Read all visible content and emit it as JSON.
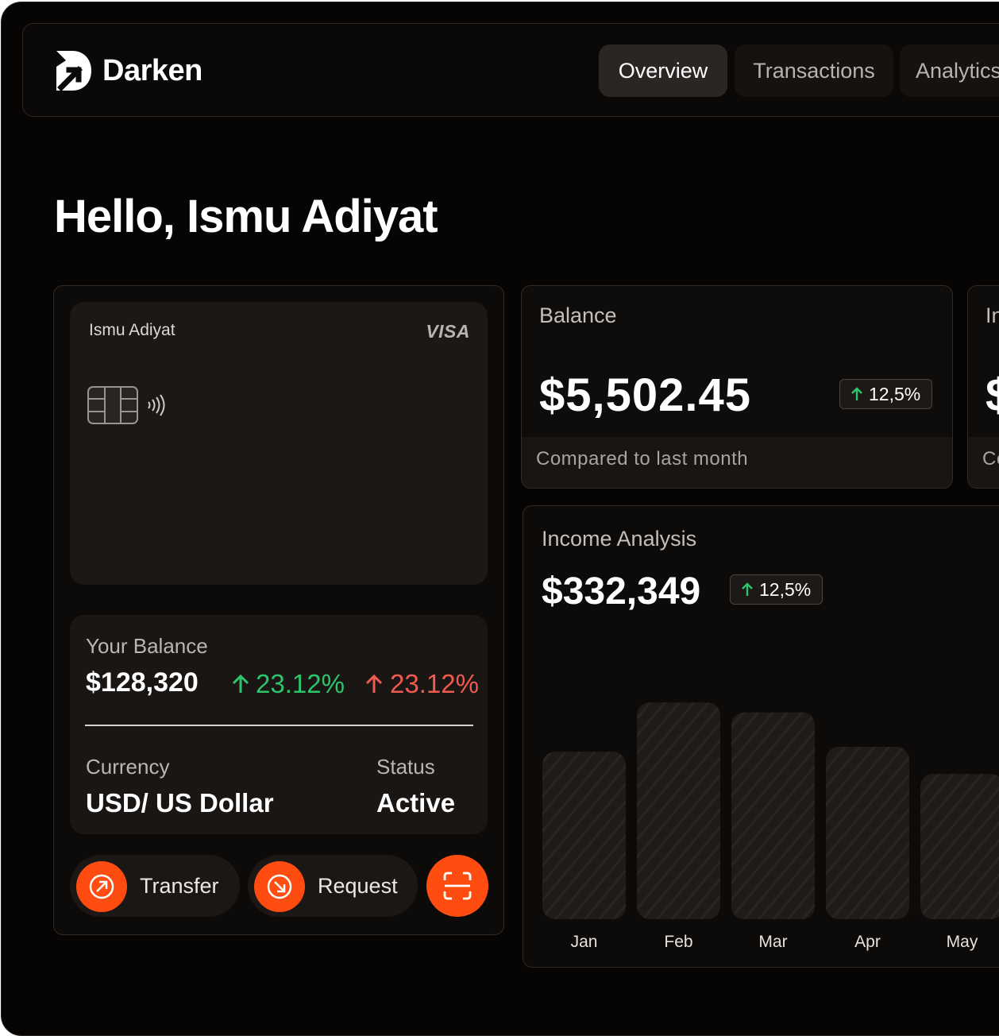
{
  "app": {
    "name": "Darken"
  },
  "nav": {
    "tabs": [
      {
        "label": "Overview",
        "active": true
      },
      {
        "label": "Transactions",
        "active": false
      },
      {
        "label": "Analytics",
        "active": false
      }
    ]
  },
  "greeting": "Hello, Ismu Adiyat",
  "card": {
    "holder": "Ismu Adiyat",
    "brand": "VISA"
  },
  "wallet": {
    "balance_label": "Your Balance",
    "balance_value": "$128,320",
    "change_up": "23.12%",
    "change_down": "23.12%",
    "currency_label": "Currency",
    "currency_value": "USD/ US Dollar",
    "status_label": "Status",
    "status_value": "Active",
    "actions": {
      "transfer": "Transfer",
      "request": "Request"
    }
  },
  "balance_card": {
    "title": "Balance",
    "value": "$5,502.45",
    "change": "12,5%",
    "footer": "Compared to last month"
  },
  "second_card": {
    "title": "In",
    "value": "$",
    "footer": "Co"
  },
  "income": {
    "title": "Income Analysis",
    "value": "$332,349",
    "change": "12,5%"
  },
  "chart_data": {
    "type": "bar",
    "categories": [
      "Jan",
      "Feb",
      "Mar",
      "Apr",
      "May"
    ],
    "values": [
      0.68,
      0.88,
      0.84,
      0.7,
      0.59
    ]
  },
  "colors": {
    "accent": "#ff4d12",
    "positive": "#2ec46b",
    "negative": "#f05a4f",
    "background": "#070504"
  }
}
